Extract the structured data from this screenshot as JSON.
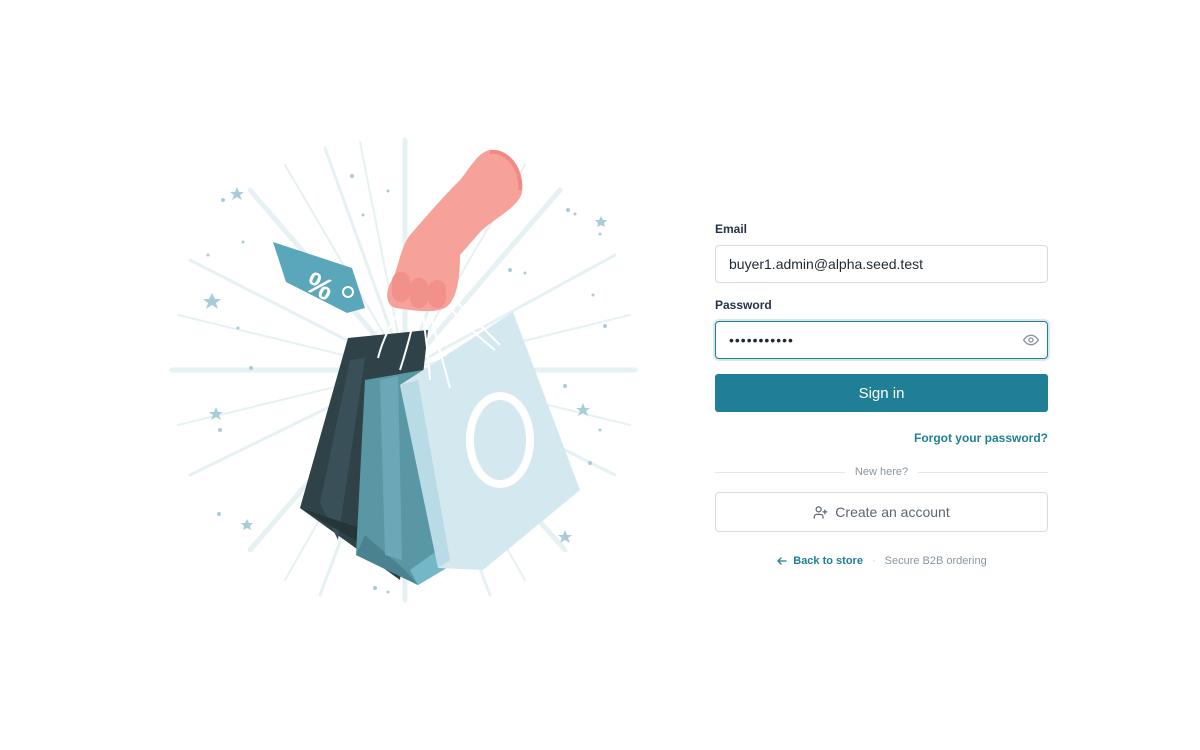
{
  "email": {
    "label": "Email",
    "value": "buyer1.admin@alpha.seed.test"
  },
  "password": {
    "label": "Password",
    "value": "pass1234567",
    "toggle_icon": "eye-icon"
  },
  "sign_in_label": "Sign in",
  "forgot_label": "Forgot your password?",
  "divider_label": "New here?",
  "create_account": {
    "label": "Create an account",
    "icon": "user-plus-icon"
  },
  "footer": {
    "back_label": "Back to store",
    "back_icon": "arrow-left-icon",
    "separator": "·",
    "tagline": "Secure B2B ordering"
  },
  "colors": {
    "accent": "#1f7f96",
    "bag_dark": "#2f4248",
    "bag_mid": "#5a97a5",
    "bag_light": "#d3e8ef",
    "hand": "#f6a19a"
  }
}
